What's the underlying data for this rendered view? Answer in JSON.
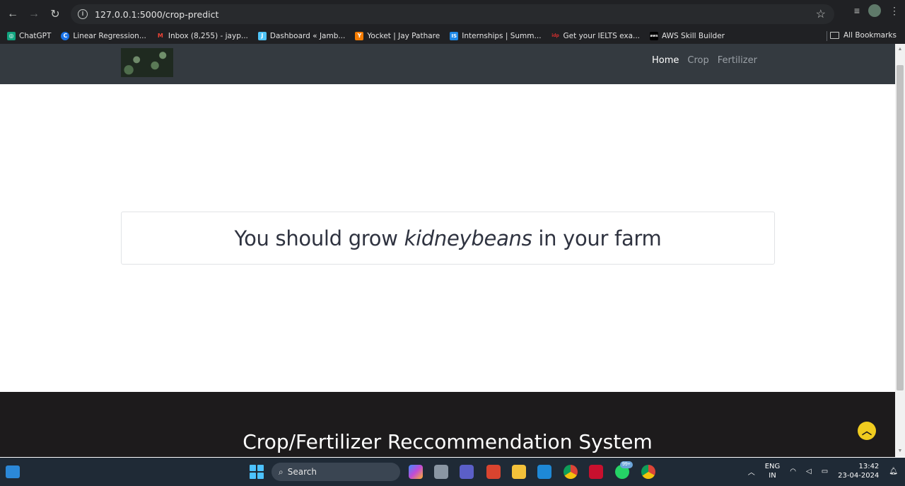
{
  "browser": {
    "url": "127.0.0.1:5000/crop-predict",
    "bookmarks": [
      {
        "label": "ChatGPT",
        "color": "#10a37f",
        "glyph": "◎"
      },
      {
        "label": "Linear Regression...",
        "color": "#1a73e8",
        "glyph": "C"
      },
      {
        "label": "Inbox (8,255) - jayp...",
        "color": "#ea4335",
        "glyph": "M"
      },
      {
        "label": "Dashboard « Jamb...",
        "color": "#4fc3f7",
        "glyph": "J"
      },
      {
        "label": "Yocket | Jay Pathare",
        "color": "#f57c00",
        "glyph": "Y"
      },
      {
        "label": "Internships | Summ...",
        "color": "#1e88e5",
        "glyph": "IS"
      },
      {
        "label": "Get your IELTS exa...",
        "color": "#d32f2f",
        "glyph": "idp"
      },
      {
        "label": "AWS Skill Builder",
        "color": "#232f3e",
        "glyph": "aws"
      }
    ],
    "all_bookmarks_label": "All Bookmarks"
  },
  "site": {
    "nav": [
      {
        "label": "Home",
        "active": true
      },
      {
        "label": "Crop",
        "active": false
      },
      {
        "label": "Fertilizer",
        "active": false
      }
    ],
    "result": {
      "prefix": "You should grow ",
      "crop": "kidneybeans",
      "suffix": " in your farm"
    },
    "footer_title": "Crop/Fertilizer Reccommendation System"
  },
  "taskbar": {
    "search_label": "Search",
    "notification_badge": "99+",
    "language": "ENG",
    "region": "IN",
    "time": "13:42",
    "date": "23-04-2024"
  }
}
